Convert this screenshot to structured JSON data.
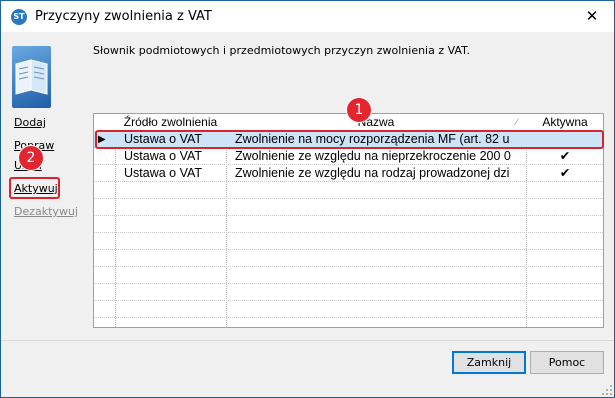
{
  "window": {
    "title": "Przyczyny zwolnienia z VAT",
    "icon_text": "ST",
    "close_glyph": "✕"
  },
  "description": "Słownik podmiotowych i przedmiotowych przyczyn zwolnienia z VAT.",
  "sidebar": {
    "items": [
      {
        "label": "Dodaj",
        "enabled": true
      },
      {
        "label": "Popraw",
        "enabled": true
      },
      {
        "label": "Usuń",
        "enabled": true
      },
      {
        "label": "Aktywuj",
        "enabled": true
      },
      {
        "label": "Dezaktywuj",
        "enabled": false
      }
    ]
  },
  "grid": {
    "columns": [
      "Źródło zwolnienia",
      "Nazwa",
      "Aktywna"
    ],
    "rows": [
      {
        "indicator": "▶",
        "source": "Ustawa o VAT",
        "name": "Zwolnienie na mocy rozporządzenia MF (art. 82 u",
        "active": ""
      },
      {
        "indicator": "",
        "source": "Ustawa o VAT",
        "name": "Zwolnienie ze względu na nieprzekroczenie 200 0",
        "active": "✔"
      },
      {
        "indicator": "",
        "source": "Ustawa o VAT",
        "name": "Zwolnienie ze względu na rodzaj prowadzonej dzi",
        "active": "✔"
      }
    ],
    "sort_glyph": "⁄"
  },
  "annotations": [
    "1",
    "2"
  ],
  "buttons": {
    "close": "Zamknij",
    "help": "Pomoc"
  },
  "colors": {
    "highlight": "#d9232e",
    "selection": "#cde3f8",
    "badge": "#e2252f"
  }
}
